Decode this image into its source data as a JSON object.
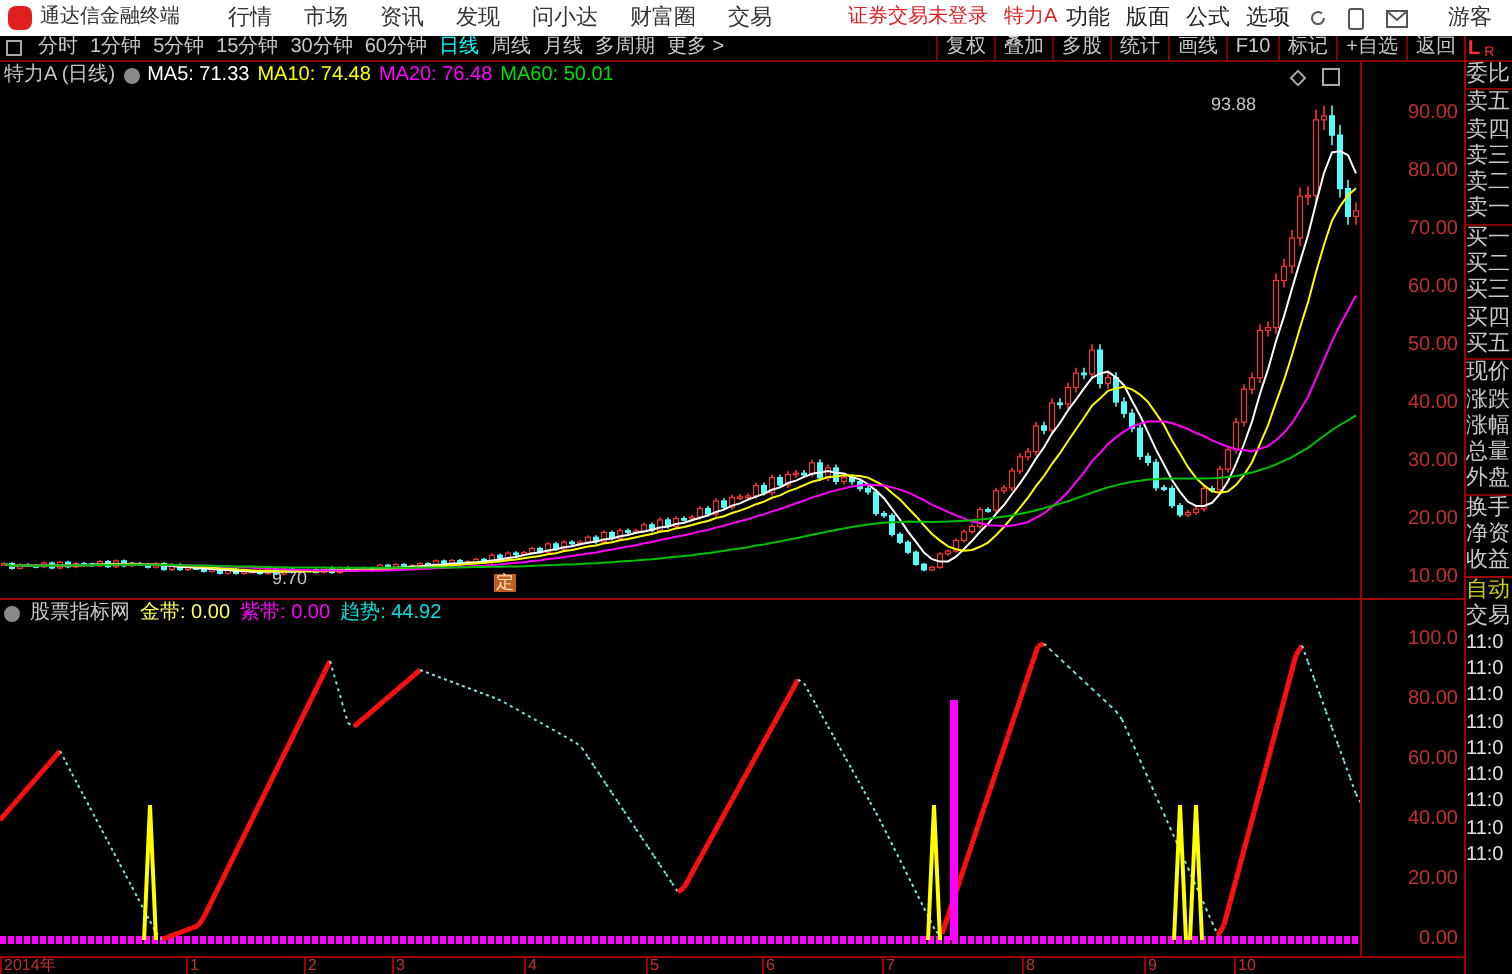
{
  "app": {
    "title": "通达信金融终端"
  },
  "menu": [
    "行情",
    "市场",
    "资讯",
    "发现",
    "问小达",
    "财富圈",
    "交易"
  ],
  "notice": [
    "证券交易未登录",
    "特力A"
  ],
  "system_menu": [
    "功能",
    "版面",
    "公式",
    "选项"
  ],
  "user": "游客",
  "periods": [
    {
      "label": "分时",
      "selected": false
    },
    {
      "label": "1分钟",
      "selected": false
    },
    {
      "label": "5分钟",
      "selected": false
    },
    {
      "label": "15分钟",
      "selected": false
    },
    {
      "label": "30分钟",
      "selected": false
    },
    {
      "label": "60分钟",
      "selected": false
    },
    {
      "label": "日线",
      "selected": true
    },
    {
      "label": "周线",
      "selected": false
    },
    {
      "label": "月线",
      "selected": false
    },
    {
      "label": "多周期",
      "selected": false
    },
    {
      "label": "更多 >",
      "selected": false
    }
  ],
  "tools": [
    "复权",
    "叠加",
    "多股",
    "统计",
    "画线",
    "F10",
    "标记",
    "+自选",
    "返回"
  ],
  "side_header": [
    "L",
    "R"
  ],
  "main_chart": {
    "title": "特力A (日线)",
    "indicators": [
      {
        "label": "MA5: 71.33",
        "color": "#ffffff"
      },
      {
        "label": "MA10: 74.48",
        "color": "#ffff00"
      },
      {
        "label": "MA20: 76.48",
        "color": "#ff00ff"
      },
      {
        "label": "MA60: 50.01",
        "color": "#00e000"
      }
    ],
    "high_label": "93.88",
    "low_label": "9.70",
    "event_marker": "定",
    "axis": [
      "90.00",
      "80.00",
      "70.00",
      "60.00",
      "50.00",
      "40.00",
      "30.00",
      "20.00",
      "10.00"
    ]
  },
  "indicator_chart": {
    "title": "股票指标网",
    "values": [
      {
        "label": "金带: 0.00",
        "color": "#ffff66"
      },
      {
        "label": "紫带: 0.00",
        "color": "#ff00ff"
      },
      {
        "label": "趋势: 44.92",
        "color": "#00e0e0"
      }
    ],
    "axis": [
      "100.0",
      "80.00",
      "60.00",
      "40.00",
      "20.00",
      "0.00"
    ]
  },
  "x_axis": [
    "2014年",
    "1",
    "2",
    "3",
    "4",
    "5",
    "6",
    "7",
    "8",
    "9",
    "10"
  ],
  "quote_panel": [
    "委比",
    "卖五",
    "卖四",
    "卖三",
    "卖二",
    "卖一",
    "买一",
    "买二",
    "买三",
    "买四",
    "买五",
    "现价",
    "涨跌",
    "涨幅",
    "总量",
    "外盘",
    "换手",
    "净资",
    "收益"
  ],
  "trade_panel": {
    "mode": "自动",
    "title": "交易",
    "times": [
      "11:0",
      "11:0",
      "11:0",
      "11:0",
      "11:0",
      "11:0",
      "11:0",
      "11:0",
      "11:0"
    ]
  }
}
